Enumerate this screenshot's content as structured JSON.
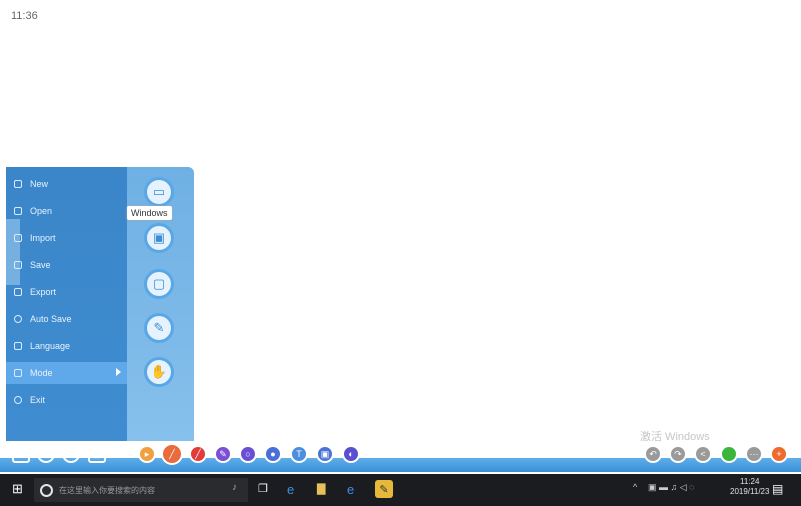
{
  "top_label": "11:36",
  "menu": {
    "items": [
      {
        "label": "New"
      },
      {
        "label": "Open"
      },
      {
        "label": "Import"
      },
      {
        "label": "Save"
      },
      {
        "label": "Export"
      },
      {
        "label": "Auto Save"
      },
      {
        "label": "Language"
      },
      {
        "label": "Mode"
      },
      {
        "label": "Exit"
      }
    ],
    "active_item": "Mode",
    "mode_tooltip": "Windows",
    "mode_buttons": [
      "windows-mode-icon",
      "desktop-mode-icon",
      "board-mode-icon",
      "pen-mode-icon",
      "hand-mode-icon"
    ]
  },
  "toolbar": {
    "tools": [
      {
        "name": "edit-icon",
        "color": "#3a8fd7"
      },
      {
        "name": "screen-icon",
        "color": "#3a8fd7"
      },
      {
        "name": "settings-icon",
        "color": "#3a8fd7"
      },
      {
        "name": "folder-icon",
        "color": "#3a8fd7"
      },
      {
        "name": "select-icon",
        "color": "#f2a03d"
      },
      {
        "name": "pen-icon",
        "color": "#ea6b3b"
      },
      {
        "name": "red-pen-icon",
        "color": "#e33b3b"
      },
      {
        "name": "highlighter-icon",
        "color": "#7b4fd6"
      },
      {
        "name": "shape-icon",
        "color": "#6a4fd6"
      },
      {
        "name": "fill-icon",
        "color": "#4b6fd9"
      },
      {
        "name": "text-icon",
        "color": "#4b8ddf"
      },
      {
        "name": "image-icon",
        "color": "#4b72d9"
      },
      {
        "name": "eraser-icon",
        "color": "#5a4fd1"
      }
    ],
    "right_tools": [
      {
        "name": "undo-icon",
        "color": "#9a9a9a"
      },
      {
        "name": "redo-icon",
        "color": "#9a9a9a"
      },
      {
        "name": "share-icon",
        "color": "#9a9a9a"
      },
      {
        "name": "green-dot-icon",
        "color": "#3bb53b"
      },
      {
        "name": "more-icon",
        "color": "#9a9a9a"
      },
      {
        "name": "add-icon",
        "color": "#ee6a2d"
      }
    ]
  },
  "watermark": "激活 Windows",
  "taskbar": {
    "search_placeholder": "在这里输入你要搜索的内容",
    "time": "11:24",
    "date": "2019/11/23"
  }
}
